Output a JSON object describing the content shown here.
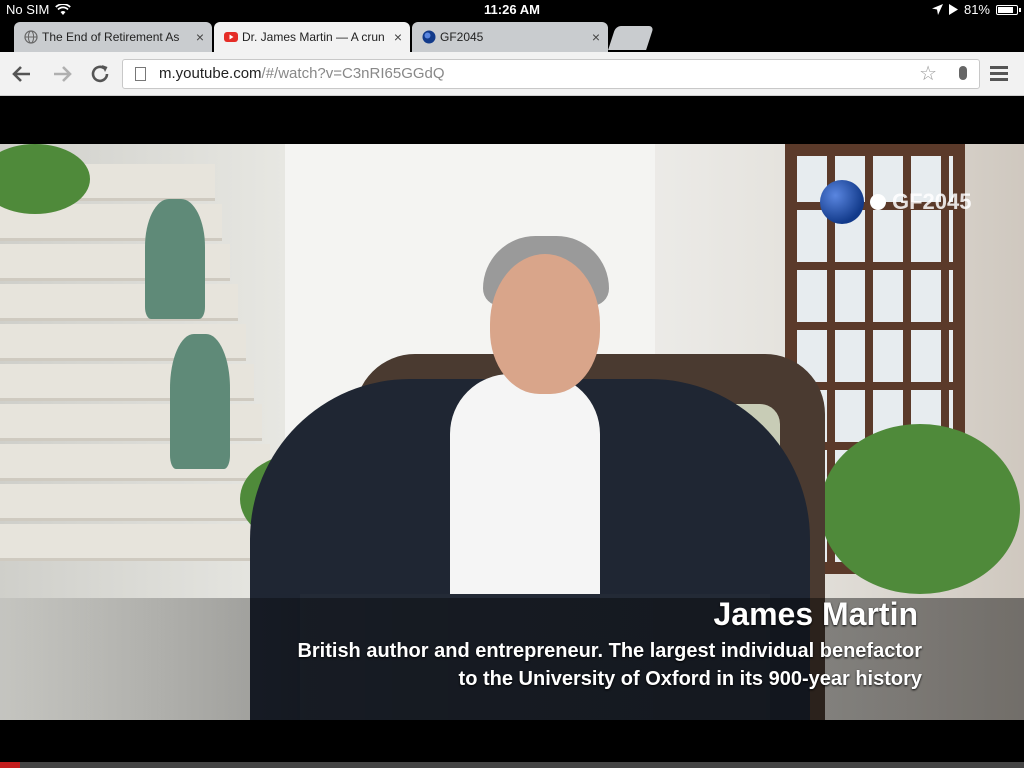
{
  "status_bar": {
    "carrier": "No SIM",
    "time": "11:26 AM",
    "battery_text": "81%",
    "battery_level": 0.81
  },
  "tabs": [
    {
      "title": "The End of Retirement As",
      "icon": "globe-icon",
      "active": false
    },
    {
      "title": "Dr. James Martin — A crun",
      "icon": "youtube-icon",
      "active": true
    },
    {
      "title": "GF2045",
      "icon": "gf2045-icon",
      "active": false
    }
  ],
  "tab_close_glyph": "×",
  "address_bar": {
    "host": "m.youtube.com",
    "path": "/#/watch?v=C3nRI65GGdQ"
  },
  "video": {
    "logo_text": "GF2045",
    "caption_name": "James Martin",
    "caption_line1": "British author and entrepreneur. The largest individual benefactor",
    "caption_line2": "to the University of Oxford in its 900-year history",
    "progress": 0.02
  },
  "colors": {
    "accent": "#c21d1d",
    "youtube_red": "#e52d27",
    "gf_blue": "#123a8a"
  }
}
